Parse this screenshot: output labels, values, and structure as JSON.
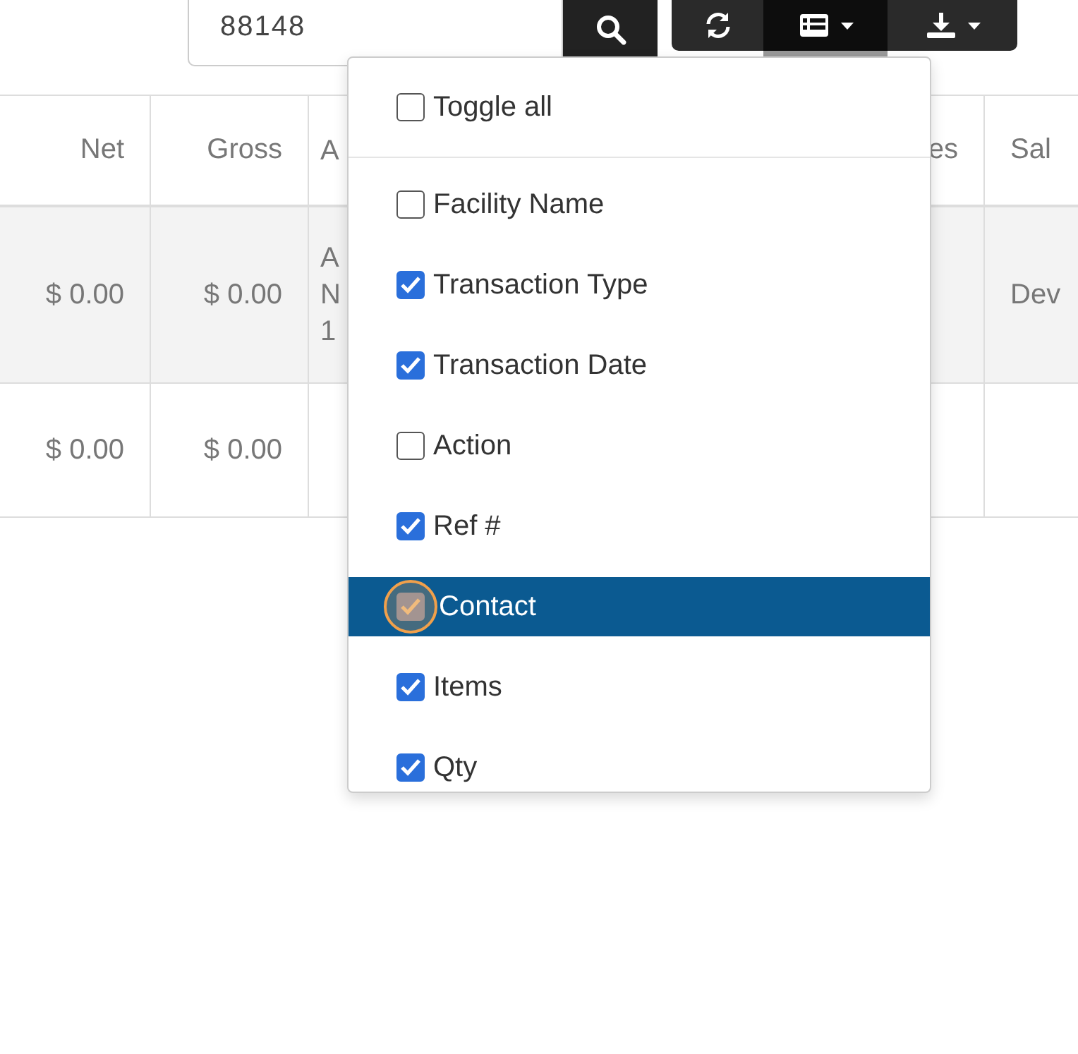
{
  "search": {
    "value": "88148"
  },
  "toolbar": [
    {
      "kind": "refresh",
      "active": false,
      "caret": false
    },
    {
      "kind": "columns",
      "active": true,
      "caret": true
    },
    {
      "kind": "download",
      "active": false,
      "caret": true
    }
  ],
  "table": {
    "columns": [
      {
        "label": "Net"
      },
      {
        "label": "Gross"
      },
      {
        "label": "A"
      },
      {
        "label": "es"
      },
      {
        "label": "Sal"
      }
    ],
    "rows": [
      {
        "cells": [
          "$ 0.00",
          "$ 0.00",
          "A N 1",
          "",
          "Dev"
        ]
      },
      {
        "cells": [
          "$ 0.00",
          "$ 0.00",
          "",
          "",
          ""
        ]
      }
    ]
  },
  "column_menu": {
    "toggle_all": {
      "label": "Toggle all",
      "checked": false
    },
    "items": [
      {
        "label": "Facility Name",
        "checked": false,
        "selected": false
      },
      {
        "label": "Transaction Type",
        "checked": true,
        "selected": false
      },
      {
        "label": "Transaction Date",
        "checked": true,
        "selected": false
      },
      {
        "label": "Action",
        "checked": false,
        "selected": false
      },
      {
        "label": "Ref #",
        "checked": true,
        "selected": false
      },
      {
        "label": "Contact",
        "checked": true,
        "selected": true
      },
      {
        "label": "Items",
        "checked": true,
        "selected": false
      },
      {
        "label": "Qty",
        "checked": true,
        "selected": false
      }
    ]
  }
}
